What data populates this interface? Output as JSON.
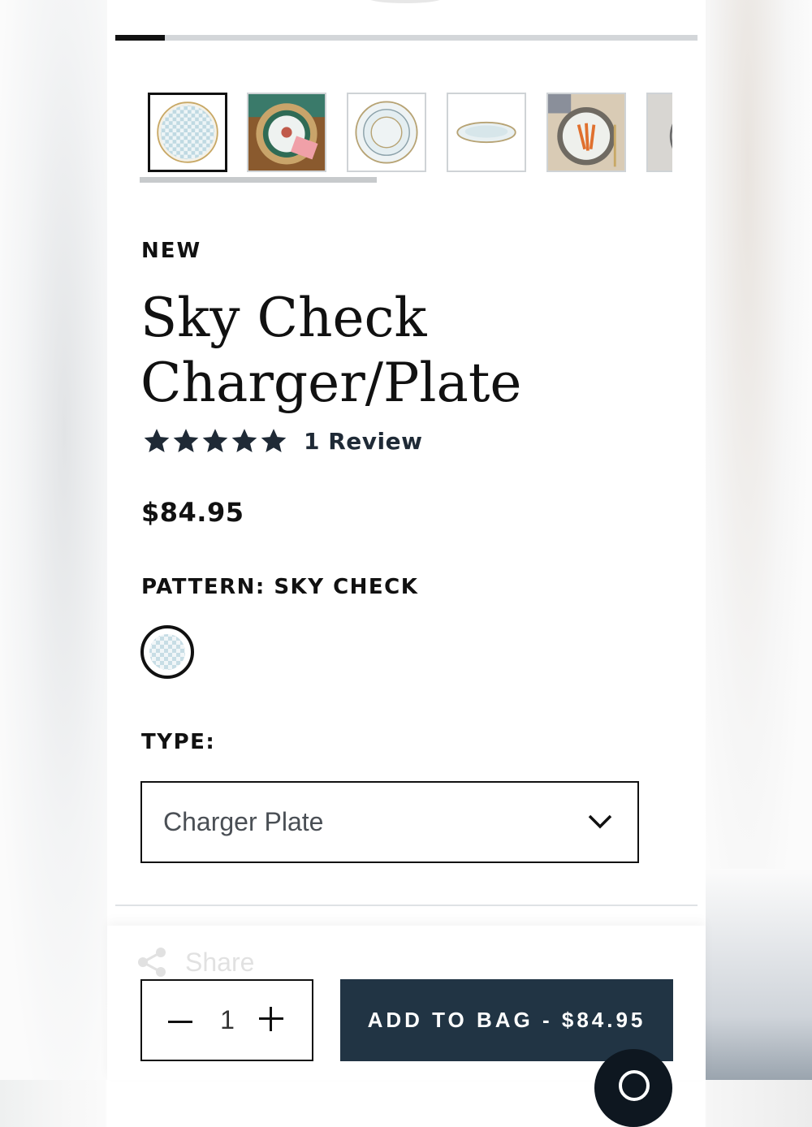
{
  "gallery": {
    "progress_fraction": 0.085,
    "thumbnails": [
      {
        "name": "plate-front",
        "active": true
      },
      {
        "name": "table-setting-green",
        "active": false
      },
      {
        "name": "plate-stack",
        "active": false
      },
      {
        "name": "plate-side-view",
        "active": false
      },
      {
        "name": "table-setting-carrots",
        "active": false
      },
      {
        "name": "plate-partial",
        "active": false
      }
    ]
  },
  "product": {
    "badge": "NEW",
    "title": "Sky Check Charger/Plate",
    "rating": 5,
    "review_text": "1 Review",
    "price": "$84.95"
  },
  "pattern": {
    "label": "PATTERN: SKY CHECK"
  },
  "type": {
    "label": "TYPE:",
    "selected": "Charger Plate"
  },
  "actions": {
    "share_label": "Share",
    "quantity": "1",
    "add_to_bag_label": "ADD TO BAG - $84.95"
  },
  "colors": {
    "primary_button": "#213444",
    "star": "#1f2a36",
    "border": "#111111"
  }
}
